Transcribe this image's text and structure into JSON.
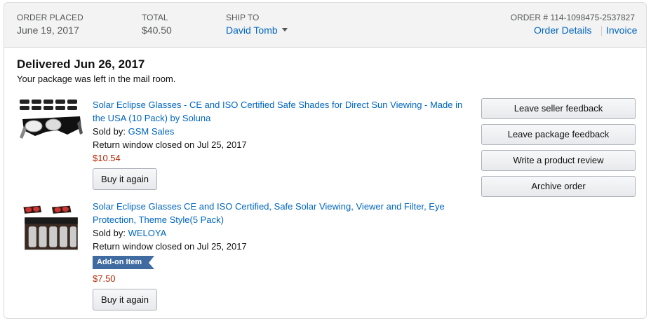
{
  "header": {
    "order_placed_label": "ORDER PLACED",
    "order_placed_value": "June 19, 2017",
    "total_label": "TOTAL",
    "total_value": "$40.50",
    "ship_to_label": "SHIP TO",
    "ship_to_value": "David Tomb",
    "order_number": "ORDER # 114-1098475-2537827",
    "order_details_link": "Order Details",
    "invoice_link": "Invoice"
  },
  "shipment": {
    "delivered_title": "Delivered Jun 26, 2017",
    "delivery_note": "Your package was left in the mail room."
  },
  "items": [
    {
      "title_line1": "Solar Eclipse Glasses - CE and ISO Certified Safe Shades for Direct Sun Viewing - Made in",
      "title_line2": "the USA (10 Pack) by Soluna",
      "sold_by_label": "Sold by:",
      "seller": "GSM Sales",
      "return_window": "Return window closed on Jul 25, 2017",
      "price": "$10.54",
      "buy_again": "Buy it again",
      "thumbnail": "eclipse-glasses-10-pack-image"
    },
    {
      "title_line1": "Solar Eclipse Glasses CE and ISO Certified, Safe Solar Viewing, Viewer and Filter, Eye",
      "title_line2": "Protection, Theme Style(5 Pack)",
      "sold_by_label": "Sold by:",
      "seller": "WELOYA",
      "return_window": "Return window closed on Jul 25, 2017",
      "badge": "Add-on Item",
      "price": "$7.50",
      "buy_again": "Buy it again",
      "thumbnail": "eclipse-glasses-5-pack-image"
    }
  ],
  "actions": {
    "seller_feedback": "Leave seller feedback",
    "package_feedback": "Leave package feedback",
    "product_review": "Write a product review",
    "archive": "Archive order"
  },
  "colors": {
    "link": "#0066c0",
    "price": "#b12704",
    "addon_badge": "#3f6ba0",
    "header_bg": "#f3f3f3"
  }
}
